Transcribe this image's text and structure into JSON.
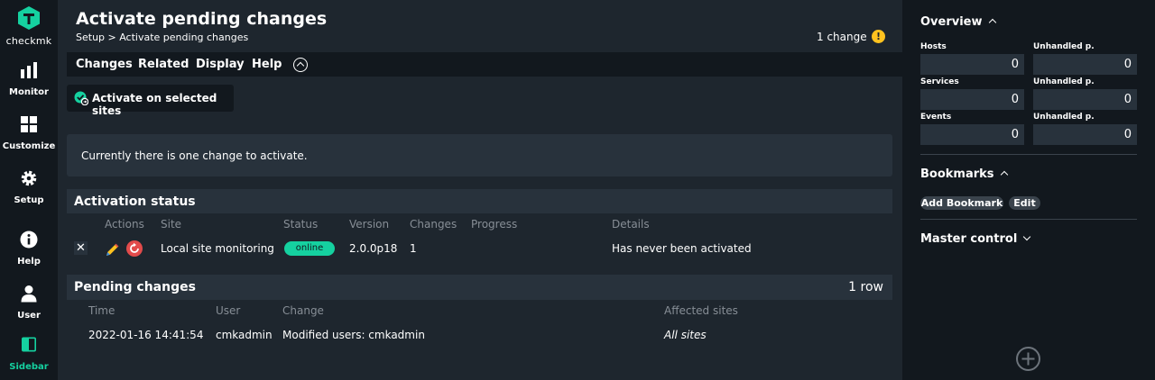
{
  "nav": {
    "logo_text": "checkmk",
    "items": [
      {
        "label": "Monitor",
        "icon": "monitor-icon"
      },
      {
        "label": "Customize",
        "icon": "customize-icon"
      },
      {
        "label": "Setup",
        "icon": "gear-icon"
      },
      {
        "label": "Help",
        "icon": "help-icon"
      },
      {
        "label": "User",
        "icon": "user-icon"
      },
      {
        "label": "Sidebar",
        "icon": "sidebar-icon"
      }
    ]
  },
  "header": {
    "title": "Activate pending changes",
    "breadcrumb": "Setup > Activate pending changes",
    "change_count": "1 change",
    "warn_icon": "!"
  },
  "menu": {
    "items": [
      "Changes",
      "Related",
      "Display",
      "Help"
    ]
  },
  "activate_button": "Activate on selected sites",
  "info_message": "Currently there is one change to activate.",
  "activation_status": {
    "title": "Activation status",
    "columns": [
      "Actions",
      "Site",
      "Status",
      "Version",
      "Changes",
      "Progress",
      "Details"
    ],
    "row": {
      "delete": "✕",
      "site": "Local site monitoring",
      "status": "online",
      "version": "2.0.0p18",
      "changes": "1",
      "progress": "",
      "details": "Has never been activated"
    }
  },
  "pending_changes": {
    "title": "Pending changes",
    "row_count": "1 row",
    "columns": [
      "Time",
      "User",
      "Change",
      "Affected sites"
    ],
    "row": {
      "time": "2022-01-16 14:41:54",
      "user": "cmkadmin",
      "change": "Modified users: cmkadmin",
      "affected_sites": "All sites"
    }
  },
  "sidebar": {
    "overview": {
      "title": "Overview",
      "hosts_label": "Hosts",
      "hosts_value": "0",
      "hosts_unhandled_label": "Unhandled p.",
      "hosts_unhandled_value": "0",
      "services_label": "Services",
      "services_value": "0",
      "services_unhandled_label": "Unhandled p.",
      "services_unhandled_value": "0",
      "events_label": "Events",
      "events_value": "0",
      "events_unhandled_label": "Unhandled p.",
      "events_unhandled_value": "0"
    },
    "bookmarks": {
      "title": "Bookmarks",
      "add": "Add Bookmark",
      "edit": "Edit"
    },
    "master_control": {
      "title": "Master control"
    }
  },
  "colors": {
    "accent": "#15d1a0",
    "warning": "#ffc21f",
    "background": "#1e262e",
    "panel": "#12181e"
  }
}
